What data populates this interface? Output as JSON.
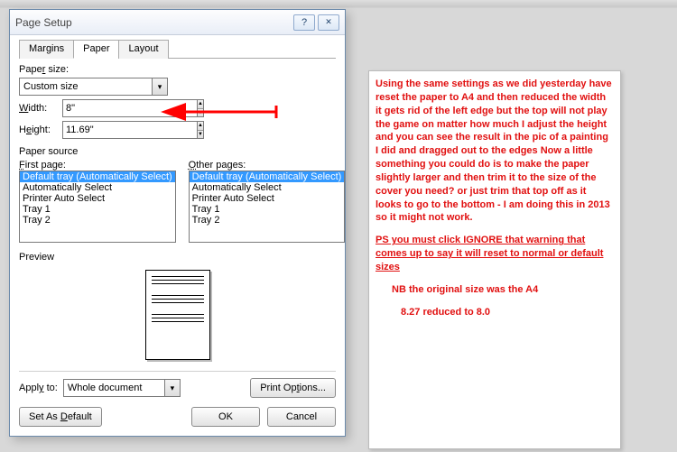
{
  "dialog": {
    "title": "Page Setup",
    "tabs": {
      "margins": "Margins",
      "paper": "Paper",
      "layout": "Layout"
    },
    "paper_size_label": "Paper size:",
    "paper_size_value": "Custom size",
    "width_label": "Width:",
    "width_value": "8\"",
    "height_label": "Height:",
    "height_value": "11.69\"",
    "paper_source_label": "Paper source",
    "first_page_label": "First page:",
    "other_pages_label": "Other pages:",
    "tray_items": [
      "Default tray (Automatically Select)",
      "Automatically Select",
      "Printer Auto Select",
      "Tray 1",
      "Tray 2"
    ],
    "preview_label": "Preview",
    "apply_to_label": "Apply to:",
    "apply_to_value": "Whole document",
    "print_options": "Print Options...",
    "set_default": "Set As Default",
    "ok": "OK",
    "cancel": "Cancel"
  },
  "note": {
    "body": "Using the same settings as we did yesterday have reset the paper to A4 and then reduced the width it gets rid of the left edge but the top will not play the game on matter how much I adjust the height and you can see the result in the pic of a painting I did and dragged out to the edges Now a little something you could do is to make the paper slightly larger and then trim it to the size  of the cover you need? or just trim that top off as it looks to go to the bottom - I am doing this in 2013 so it might not work.",
    "ps": "PS you must click IGNORE  that warning that comes up to say it will reset to normal or default sizes",
    "nb1": "NB the original size was the A4",
    "nb2": "8.27 reduced to 8.0"
  }
}
